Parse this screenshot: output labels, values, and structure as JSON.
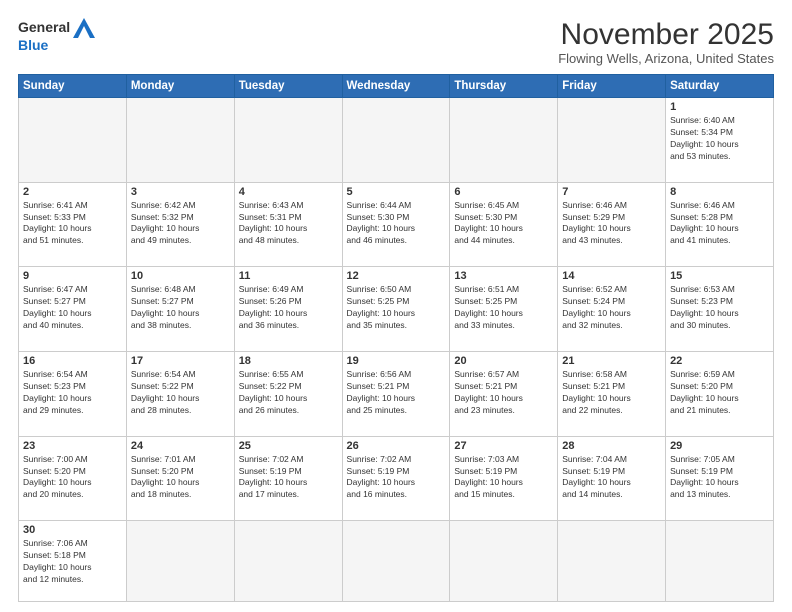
{
  "header": {
    "logo_line1": "General",
    "logo_line2": "Blue",
    "month_title": "November 2025",
    "location": "Flowing Wells, Arizona, United States"
  },
  "weekdays": [
    "Sunday",
    "Monday",
    "Tuesday",
    "Wednesday",
    "Thursday",
    "Friday",
    "Saturday"
  ],
  "weeks": [
    [
      {
        "day": "",
        "info": ""
      },
      {
        "day": "",
        "info": ""
      },
      {
        "day": "",
        "info": ""
      },
      {
        "day": "",
        "info": ""
      },
      {
        "day": "",
        "info": ""
      },
      {
        "day": "",
        "info": ""
      },
      {
        "day": "1",
        "info": "Sunrise: 6:40 AM\nSunset: 5:34 PM\nDaylight: 10 hours\nand 53 minutes."
      }
    ],
    [
      {
        "day": "2",
        "info": "Sunrise: 6:41 AM\nSunset: 5:33 PM\nDaylight: 10 hours\nand 51 minutes."
      },
      {
        "day": "3",
        "info": "Sunrise: 6:42 AM\nSunset: 5:32 PM\nDaylight: 10 hours\nand 49 minutes."
      },
      {
        "day": "4",
        "info": "Sunrise: 6:43 AM\nSunset: 5:31 PM\nDaylight: 10 hours\nand 48 minutes."
      },
      {
        "day": "5",
        "info": "Sunrise: 6:44 AM\nSunset: 5:30 PM\nDaylight: 10 hours\nand 46 minutes."
      },
      {
        "day": "6",
        "info": "Sunrise: 6:45 AM\nSunset: 5:30 PM\nDaylight: 10 hours\nand 44 minutes."
      },
      {
        "day": "7",
        "info": "Sunrise: 6:46 AM\nSunset: 5:29 PM\nDaylight: 10 hours\nand 43 minutes."
      },
      {
        "day": "8",
        "info": "Sunrise: 6:46 AM\nSunset: 5:28 PM\nDaylight: 10 hours\nand 41 minutes."
      }
    ],
    [
      {
        "day": "9",
        "info": "Sunrise: 6:47 AM\nSunset: 5:27 PM\nDaylight: 10 hours\nand 40 minutes."
      },
      {
        "day": "10",
        "info": "Sunrise: 6:48 AM\nSunset: 5:27 PM\nDaylight: 10 hours\nand 38 minutes."
      },
      {
        "day": "11",
        "info": "Sunrise: 6:49 AM\nSunset: 5:26 PM\nDaylight: 10 hours\nand 36 minutes."
      },
      {
        "day": "12",
        "info": "Sunrise: 6:50 AM\nSunset: 5:25 PM\nDaylight: 10 hours\nand 35 minutes."
      },
      {
        "day": "13",
        "info": "Sunrise: 6:51 AM\nSunset: 5:25 PM\nDaylight: 10 hours\nand 33 minutes."
      },
      {
        "day": "14",
        "info": "Sunrise: 6:52 AM\nSunset: 5:24 PM\nDaylight: 10 hours\nand 32 minutes."
      },
      {
        "day": "15",
        "info": "Sunrise: 6:53 AM\nSunset: 5:23 PM\nDaylight: 10 hours\nand 30 minutes."
      }
    ],
    [
      {
        "day": "16",
        "info": "Sunrise: 6:54 AM\nSunset: 5:23 PM\nDaylight: 10 hours\nand 29 minutes."
      },
      {
        "day": "17",
        "info": "Sunrise: 6:54 AM\nSunset: 5:22 PM\nDaylight: 10 hours\nand 28 minutes."
      },
      {
        "day": "18",
        "info": "Sunrise: 6:55 AM\nSunset: 5:22 PM\nDaylight: 10 hours\nand 26 minutes."
      },
      {
        "day": "19",
        "info": "Sunrise: 6:56 AM\nSunset: 5:21 PM\nDaylight: 10 hours\nand 25 minutes."
      },
      {
        "day": "20",
        "info": "Sunrise: 6:57 AM\nSunset: 5:21 PM\nDaylight: 10 hours\nand 23 minutes."
      },
      {
        "day": "21",
        "info": "Sunrise: 6:58 AM\nSunset: 5:21 PM\nDaylight: 10 hours\nand 22 minutes."
      },
      {
        "day": "22",
        "info": "Sunrise: 6:59 AM\nSunset: 5:20 PM\nDaylight: 10 hours\nand 21 minutes."
      }
    ],
    [
      {
        "day": "23",
        "info": "Sunrise: 7:00 AM\nSunset: 5:20 PM\nDaylight: 10 hours\nand 20 minutes."
      },
      {
        "day": "24",
        "info": "Sunrise: 7:01 AM\nSunset: 5:20 PM\nDaylight: 10 hours\nand 18 minutes."
      },
      {
        "day": "25",
        "info": "Sunrise: 7:02 AM\nSunset: 5:19 PM\nDaylight: 10 hours\nand 17 minutes."
      },
      {
        "day": "26",
        "info": "Sunrise: 7:02 AM\nSunset: 5:19 PM\nDaylight: 10 hours\nand 16 minutes."
      },
      {
        "day": "27",
        "info": "Sunrise: 7:03 AM\nSunset: 5:19 PM\nDaylight: 10 hours\nand 15 minutes."
      },
      {
        "day": "28",
        "info": "Sunrise: 7:04 AM\nSunset: 5:19 PM\nDaylight: 10 hours\nand 14 minutes."
      },
      {
        "day": "29",
        "info": "Sunrise: 7:05 AM\nSunset: 5:19 PM\nDaylight: 10 hours\nand 13 minutes."
      }
    ],
    [
      {
        "day": "30",
        "info": "Sunrise: 7:06 AM\nSunset: 5:18 PM\nDaylight: 10 hours\nand 12 minutes."
      },
      {
        "day": "",
        "info": ""
      },
      {
        "day": "",
        "info": ""
      },
      {
        "day": "",
        "info": ""
      },
      {
        "day": "",
        "info": ""
      },
      {
        "day": "",
        "info": ""
      },
      {
        "day": "",
        "info": ""
      }
    ]
  ]
}
